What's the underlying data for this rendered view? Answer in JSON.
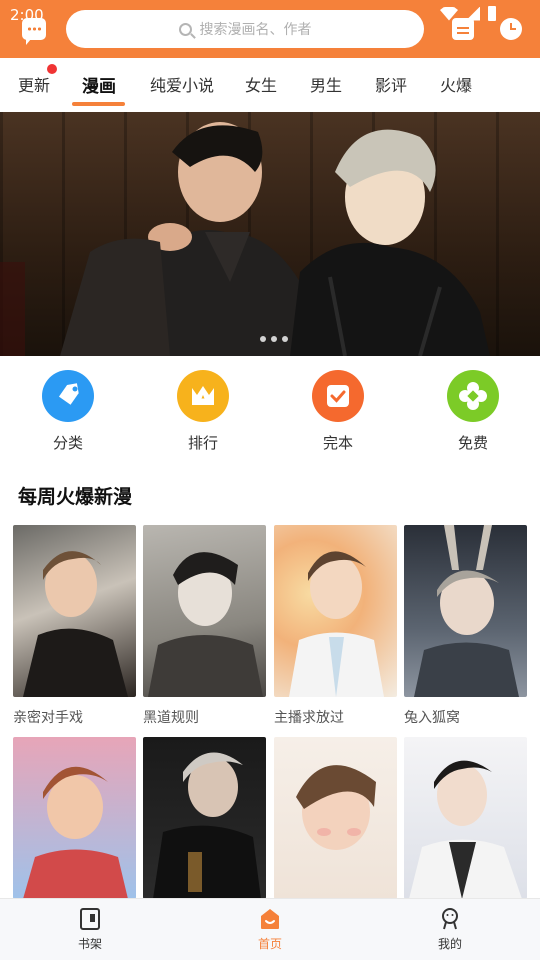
{
  "status_bar": {
    "time": "2:00"
  },
  "search": {
    "placeholder": "搜索漫画名、作者"
  },
  "tabs": [
    {
      "label": "更新",
      "has_badge": true
    },
    {
      "label": "漫画",
      "active": true
    },
    {
      "label": "纯爱小说"
    },
    {
      "label": "女生"
    },
    {
      "label": "男生"
    },
    {
      "label": "影评"
    },
    {
      "label": "火爆"
    }
  ],
  "banner": {
    "page_count": 3
  },
  "categories": [
    {
      "label": "分类",
      "icon": "tag-icon",
      "color": "#2b9af3"
    },
    {
      "label": "排行",
      "icon": "crown-icon",
      "color": "#f7b21c"
    },
    {
      "label": "完本",
      "icon": "checkbox-icon",
      "color": "#f5692e"
    },
    {
      "label": "免费",
      "icon": "diamond-icon",
      "color": "#7ccb27"
    }
  ],
  "section": {
    "title": "每周火爆新漫"
  },
  "comics": [
    {
      "title": "亲密对手戏"
    },
    {
      "title": "黑道规则"
    },
    {
      "title": "主播求放过"
    },
    {
      "title": "兔入狐窝"
    },
    {
      "title": ""
    },
    {
      "title": ""
    },
    {
      "title": ""
    },
    {
      "title": ""
    }
  ],
  "bottom_nav": [
    {
      "label": "书架",
      "icon": "bookshelf-icon"
    },
    {
      "label": "首页",
      "icon": "home-icon",
      "active": true
    },
    {
      "label": "我的",
      "icon": "profile-icon"
    }
  ],
  "colors": {
    "accent": "#f5813a",
    "badge": "#f03434"
  }
}
